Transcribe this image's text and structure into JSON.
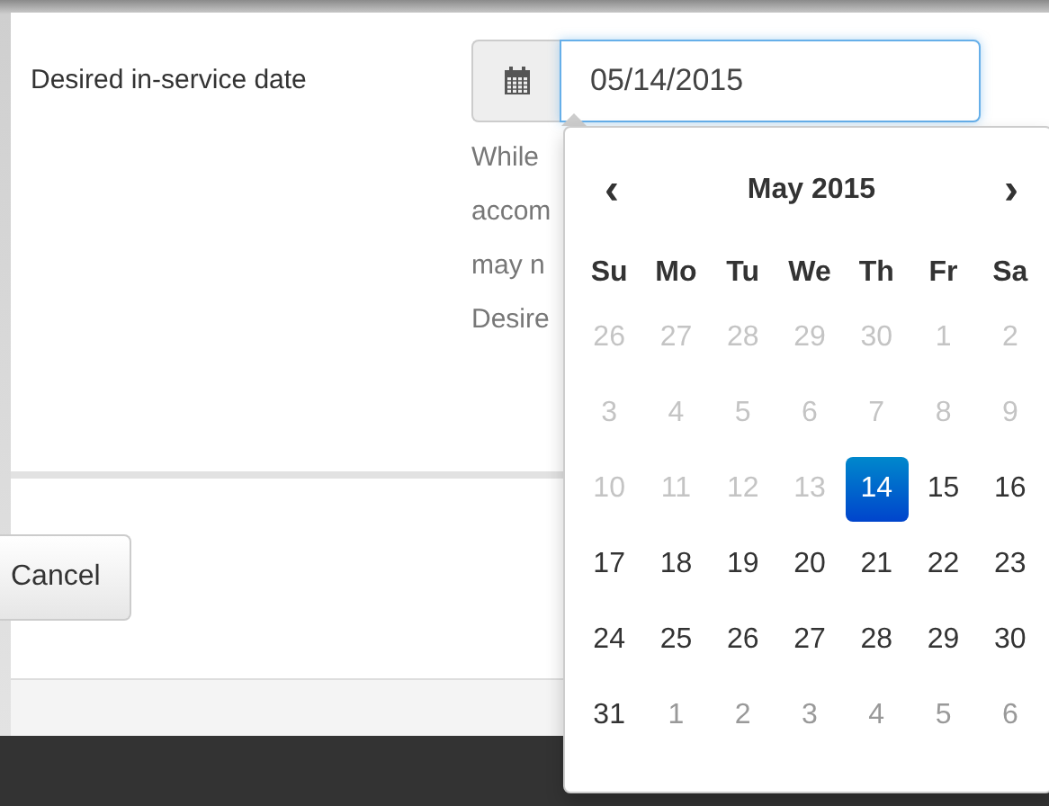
{
  "field": {
    "label": "Desired in-service date",
    "value": "05/14/2015"
  },
  "help_lines": [
    "While",
    "accom",
    "may n",
    "Desire"
  ],
  "cancel_button": "Cancel",
  "datepicker": {
    "prev": "‹",
    "title": "May 2015",
    "next": "›",
    "weekdays": [
      "Su",
      "Mo",
      "Tu",
      "We",
      "Th",
      "Fr",
      "Sa"
    ],
    "days": [
      {
        "label": "26",
        "kind": "disabled",
        "selected": false
      },
      {
        "label": "27",
        "kind": "disabled",
        "selected": false
      },
      {
        "label": "28",
        "kind": "disabled",
        "selected": false
      },
      {
        "label": "29",
        "kind": "disabled",
        "selected": false
      },
      {
        "label": "30",
        "kind": "disabled",
        "selected": false
      },
      {
        "label": "1",
        "kind": "disabled",
        "selected": false
      },
      {
        "label": "2",
        "kind": "disabled",
        "selected": false
      },
      {
        "label": "3",
        "kind": "disabled",
        "selected": false
      },
      {
        "label": "4",
        "kind": "disabled",
        "selected": false
      },
      {
        "label": "5",
        "kind": "disabled",
        "selected": false
      },
      {
        "label": "6",
        "kind": "disabled",
        "selected": false
      },
      {
        "label": "7",
        "kind": "disabled",
        "selected": false
      },
      {
        "label": "8",
        "kind": "disabled",
        "selected": false
      },
      {
        "label": "9",
        "kind": "disabled",
        "selected": false
      },
      {
        "label": "10",
        "kind": "disabled",
        "selected": false
      },
      {
        "label": "11",
        "kind": "disabled",
        "selected": false
      },
      {
        "label": "12",
        "kind": "disabled",
        "selected": false
      },
      {
        "label": "13",
        "kind": "disabled",
        "selected": false
      },
      {
        "label": "14",
        "kind": "day",
        "selected": true
      },
      {
        "label": "15",
        "kind": "day",
        "selected": false
      },
      {
        "label": "16",
        "kind": "day",
        "selected": false
      },
      {
        "label": "17",
        "kind": "day",
        "selected": false
      },
      {
        "label": "18",
        "kind": "day",
        "selected": false
      },
      {
        "label": "19",
        "kind": "day",
        "selected": false
      },
      {
        "label": "20",
        "kind": "day",
        "selected": false
      },
      {
        "label": "21",
        "kind": "day",
        "selected": false
      },
      {
        "label": "22",
        "kind": "day",
        "selected": false
      },
      {
        "label": "23",
        "kind": "day",
        "selected": false
      },
      {
        "label": "24",
        "kind": "day",
        "selected": false
      },
      {
        "label": "25",
        "kind": "day",
        "selected": false
      },
      {
        "label": "26",
        "kind": "day",
        "selected": false
      },
      {
        "label": "27",
        "kind": "day",
        "selected": false
      },
      {
        "label": "28",
        "kind": "day",
        "selected": false
      },
      {
        "label": "29",
        "kind": "day",
        "selected": false
      },
      {
        "label": "30",
        "kind": "day",
        "selected": false
      },
      {
        "label": "31",
        "kind": "day",
        "selected": false
      },
      {
        "label": "1",
        "kind": "other",
        "selected": false
      },
      {
        "label": "2",
        "kind": "other",
        "selected": false
      },
      {
        "label": "3",
        "kind": "other",
        "selected": false
      },
      {
        "label": "4",
        "kind": "other",
        "selected": false
      },
      {
        "label": "5",
        "kind": "other",
        "selected": false
      },
      {
        "label": "6",
        "kind": "other",
        "selected": false
      }
    ]
  }
}
